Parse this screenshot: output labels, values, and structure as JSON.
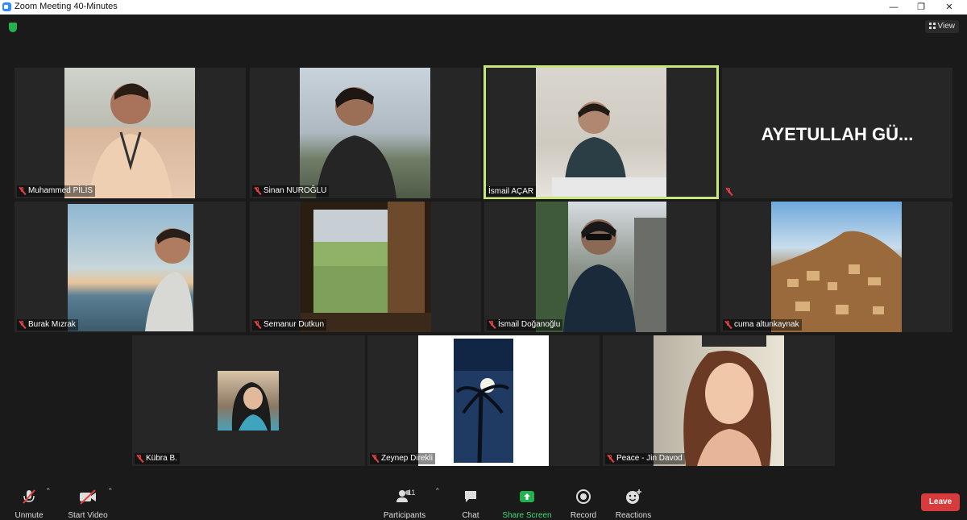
{
  "window": {
    "title": "Zoom Meeting 40-Minutes",
    "minimize": "—",
    "maximize": "❐",
    "close": "✕"
  },
  "view_button": {
    "label": "View"
  },
  "participants": [
    {
      "name": "Muhammed PİLİS"
    },
    {
      "name": "Sinan NUROĞLU"
    },
    {
      "name": "İsmail AÇAR"
    },
    {
      "name": "",
      "display": "AYETULLAH  GÜ..."
    },
    {
      "name": "Burak Mızrak"
    },
    {
      "name": "Semanur Dutkun"
    },
    {
      "name": "İsmail Doğanoğlu"
    },
    {
      "name": "cuma altunkaynak"
    },
    {
      "name": "Kübra B."
    },
    {
      "name": "Zeynep Direkli"
    },
    {
      "name": "Peace - Jin Davod"
    }
  ],
  "toolbar": {
    "unmute": "Unmute",
    "start_video": "Start Video",
    "participants_label": "Participants",
    "participants_count": "11",
    "chat": "Chat",
    "share_screen": "Share Screen",
    "record": "Record",
    "reactions": "Reactions",
    "leave": "Leave"
  },
  "colors": {
    "active_speaker": "#c8e87a",
    "share_green": "#23b14d",
    "leave_red": "#d83b3b"
  }
}
